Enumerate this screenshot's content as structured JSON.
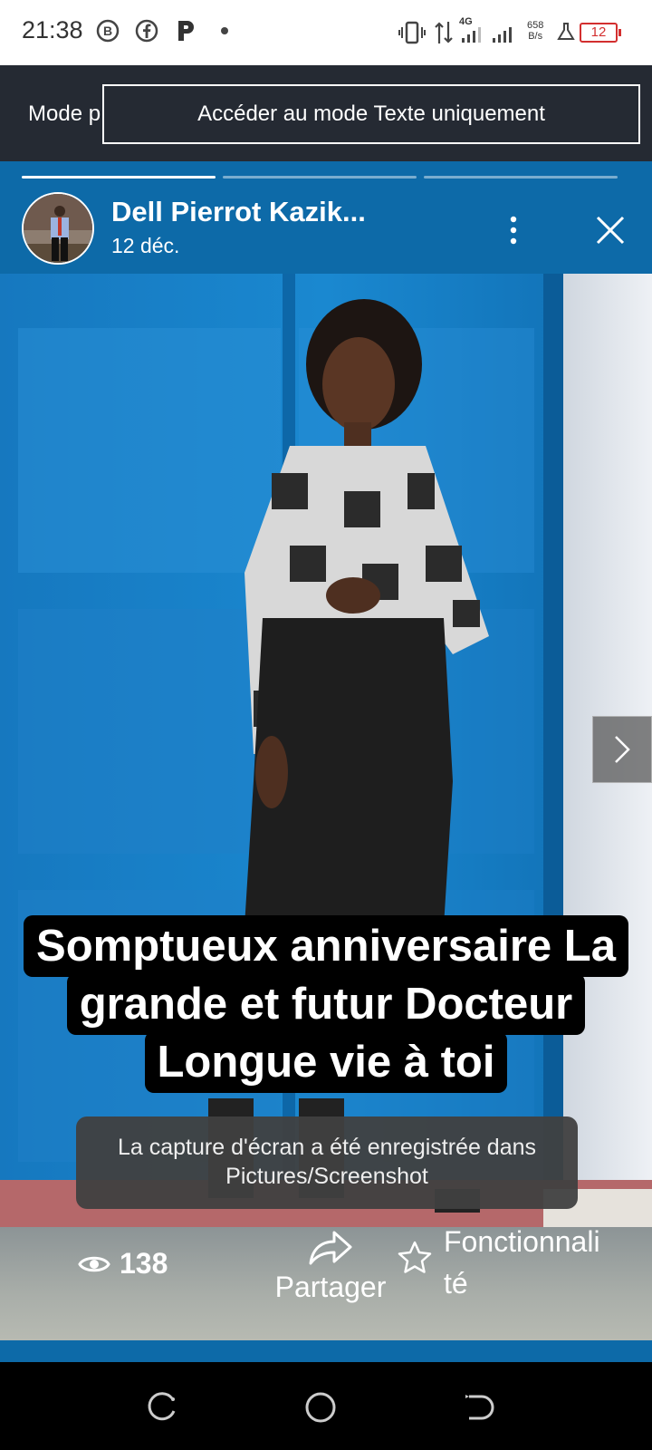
{
  "status_bar": {
    "time": "21:38",
    "icons": [
      "b-circle-icon",
      "facebook-icon",
      "p-app-icon",
      "dot-icon"
    ],
    "network_speed_value": "658",
    "network_speed_unit": "B/s",
    "network_type": "4G",
    "battery": "12"
  },
  "mode_bar": {
    "label_partial": "Mode p",
    "button_label": "Accéder au mode Texte uniquement"
  },
  "story": {
    "progress_segments": 3,
    "active_segment": 1,
    "author": "Dell Pierrot Kazik...",
    "date": "12 déc.",
    "caption_lines": [
      "Somptueux anniversaire La",
      "grande et futur Docteur",
      "Longue vie à toi"
    ],
    "views": "138",
    "share_label": "Partager",
    "feature_label_line1": "Fonctionnali",
    "feature_label_line2": "té"
  },
  "toast": {
    "line1": "La capture d'écran a été enregistrée dans",
    "line2": "Pictures/Screenshot"
  },
  "colors": {
    "story_background": "#0d6aa8",
    "mode_bar": "#252a33",
    "battery_low": "#d32f2f"
  }
}
